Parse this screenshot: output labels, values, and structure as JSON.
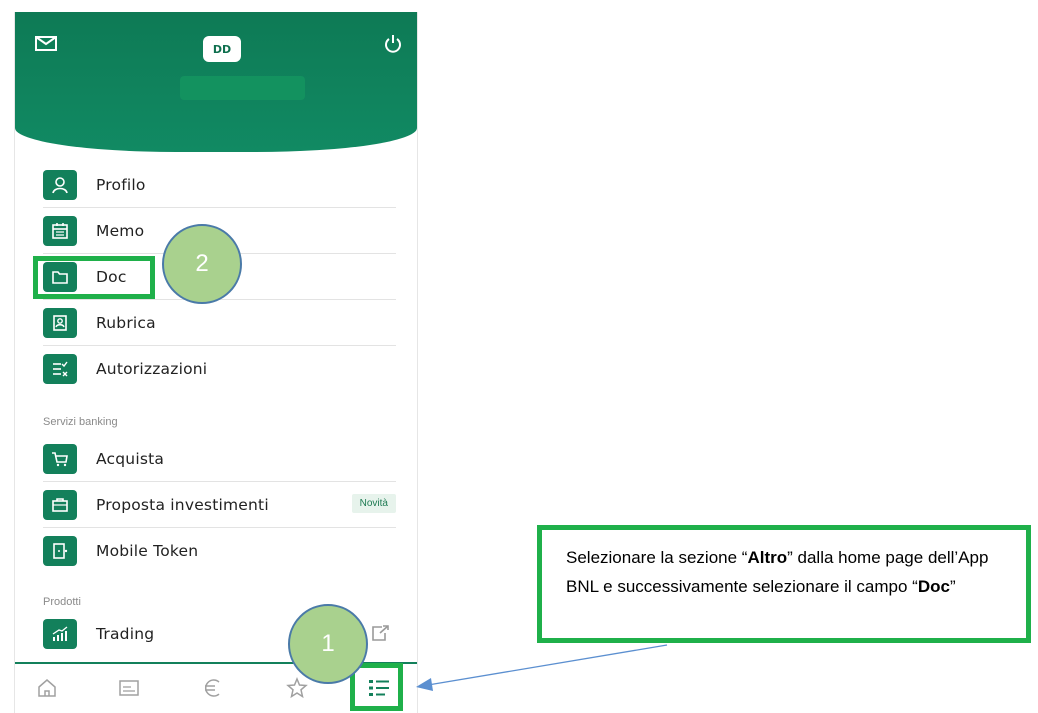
{
  "header": {
    "avatar_initials": "DD"
  },
  "menu": [
    {
      "label": "Profilo",
      "icon": "person-icon"
    },
    {
      "label": "Memo",
      "icon": "calendar-icon"
    },
    {
      "label": "Doc",
      "icon": "folder-icon"
    },
    {
      "label": "Rubrica",
      "icon": "contacts-icon"
    },
    {
      "label": "Autorizzazioni",
      "icon": "checklist-icon"
    }
  ],
  "section_banking": "Servizi banking",
  "banking": [
    {
      "label": "Acquista",
      "icon": "cart-icon"
    },
    {
      "label": "Proposta investimenti",
      "icon": "briefcase-icon",
      "badge": "Novità"
    },
    {
      "label": "Mobile Token",
      "icon": "token-icon"
    }
  ],
  "section_products": "Prodotti",
  "products": [
    {
      "label": "Trading",
      "icon": "chart-icon"
    }
  ],
  "tabbar": [
    "home-icon",
    "card-icon",
    "euro-icon",
    "star-icon",
    "menu-list-icon"
  ],
  "markers": {
    "one": "1",
    "two": "2"
  },
  "note": {
    "t1": "Selezionare la sezione “",
    "b1": "Altro",
    "t2": "” dalla home page dell’App BNL e successivamente selezionare il campo “",
    "b2": "Doc",
    "t3": "”"
  },
  "colors": {
    "brand_green": "#13805b",
    "highlight_green": "#1fb04a",
    "marker_fill": "#a9d18e",
    "arrow_blue": "#5b8fd0"
  }
}
